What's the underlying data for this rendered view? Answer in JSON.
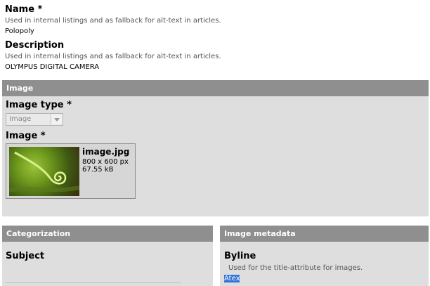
{
  "fields": {
    "name": {
      "label": "Name *",
      "help": "Used in internal listings and as fallback for alt-text in articles.",
      "value": "Polopoly"
    },
    "description": {
      "label": "Description",
      "help": "Used in internal listings and as fallback for alt-text in articles.",
      "value": "OLYMPUS DIGITAL CAMERA"
    }
  },
  "image_section": {
    "title": "Image",
    "image_type_label": "Image type *",
    "image_type_value": "Image",
    "image_label": "Image *",
    "file": {
      "name": "image.jpg",
      "dimensions": "800 x 600 px",
      "size": "67.55 kB"
    }
  },
  "categorization": {
    "title": "Categorization",
    "subject_label": "Subject"
  },
  "metadata": {
    "title": "Image metadata",
    "byline_label": "Byline",
    "byline_help": "Used for the title-attribute for images.",
    "byline_value": "Atex"
  },
  "colors": {
    "section_header": "#8f8f8f",
    "section_body": "#dedede",
    "selection": "#3373d6"
  }
}
